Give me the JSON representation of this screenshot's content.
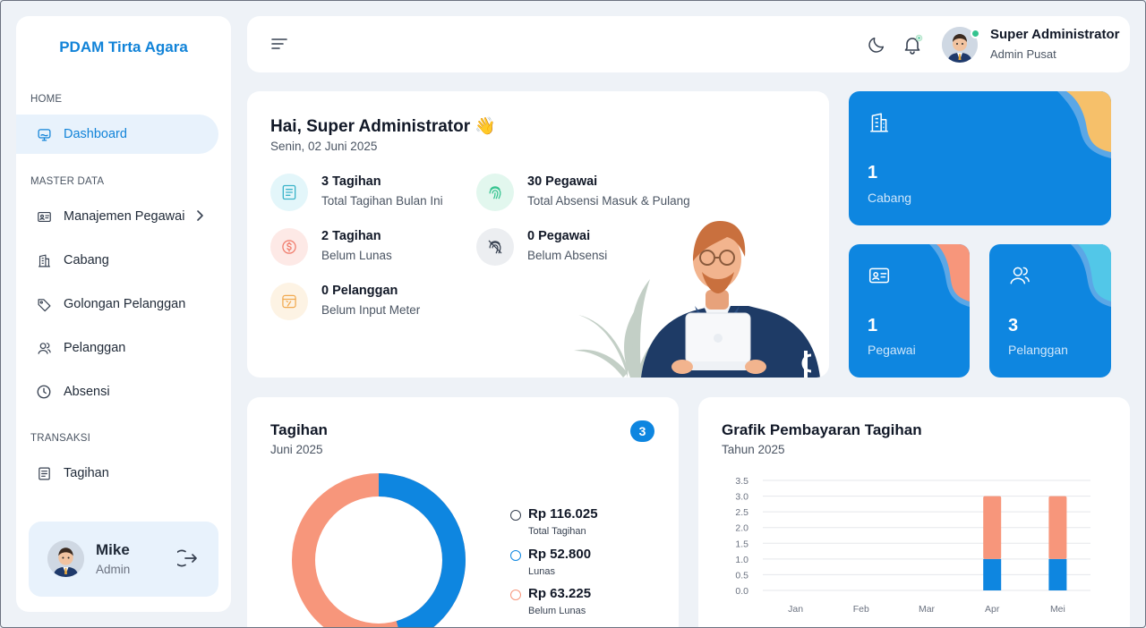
{
  "sidebar": {
    "brand": "PDAM Tirta Agara",
    "sections": [
      "HOME",
      "MASTER DATA",
      "TRANSAKSI"
    ],
    "items": [
      {
        "label": "Dashboard",
        "icon": "monitor-icon",
        "active": true
      },
      {
        "label": "Manajemen Pegawai",
        "icon": "id-card-icon"
      },
      {
        "label": "Cabang",
        "icon": "building-icon"
      },
      {
        "label": "Golongan Pelanggan",
        "icon": "tag-icon"
      },
      {
        "label": "Pelanggan",
        "icon": "users-icon"
      },
      {
        "label": "Absensi",
        "icon": "clock-icon"
      },
      {
        "label": "Tagihan",
        "icon": "receipt-icon"
      }
    ],
    "profile": {
      "name": "Mike",
      "role": "Admin"
    }
  },
  "topbar": {
    "user_name": "Super Administrator",
    "user_role": "Admin Pusat"
  },
  "welcome": {
    "greeting": "Hai, Super Administrator 👋",
    "date": "Senin, 02 Juni 2025",
    "stats": [
      {
        "title": "3 Tagihan",
        "sub": "Total Tagihan Bulan Ini",
        "icon": "receipt-icon",
        "color": "#3bb4c9",
        "bg": "#e3f6fa"
      },
      {
        "title": "30 Pegawai",
        "sub": "Total Absensi Masuk & Pulang",
        "icon": "fingerprint-icon",
        "color": "#34c38f",
        "bg": "#e2f7ee"
      },
      {
        "title": "2 Tagihan",
        "sub": "Belum Lunas",
        "icon": "dollar-circle-icon",
        "color": "#f07a6a",
        "bg": "#fde9e6"
      },
      {
        "title": "0 Pegawai",
        "sub": "Belum Absensi",
        "icon": "fingerprint-off-icon",
        "color": "#374151",
        "bg": "#eceef1"
      },
      {
        "title": "0 Pelanggan",
        "sub": "Belum Input Meter",
        "icon": "meter-icon",
        "color": "#f1a94f",
        "bg": "#fdf3e4"
      }
    ]
  },
  "tiles": [
    {
      "num": "1",
      "label": "Cabang",
      "icon": "building-icon"
    },
    {
      "num": "1",
      "label": "Pegawai",
      "icon": "id-card-icon"
    },
    {
      "num": "3",
      "label": "Pelanggan",
      "icon": "users-icon"
    }
  ],
  "tagihan": {
    "title": "Tagihan",
    "subtitle": "Juni 2025",
    "count": "3",
    "legend": [
      {
        "value": "Rp 116.025",
        "label": "Total Tagihan",
        "color": "#374151"
      },
      {
        "value": "Rp 52.800",
        "label": "Lunas",
        "color": "#0e86e0"
      },
      {
        "value": "Rp 63.225",
        "label": "Belum Lunas",
        "color": "#f7967b"
      }
    ],
    "donut": {
      "lunas": 52800,
      "belum_lunas": 63225
    }
  },
  "grafik": {
    "title": "Grafik Pembayaran Tagihan",
    "subtitle": "Tahun 2025"
  },
  "colors": {
    "primary": "#0e86e0",
    "accent": "#f7967b"
  },
  "chart_data": {
    "type": "bar",
    "stacked": true,
    "categories": [
      "Jan",
      "Feb",
      "Mar",
      "Apr",
      "Mei"
    ],
    "series": [
      {
        "color": "#0e86e0",
        "values": [
          0,
          0,
          0,
          1,
          1
        ]
      },
      {
        "color": "#f7967b",
        "values": [
          0,
          0,
          0,
          2,
          2
        ]
      }
    ],
    "ylim": [
      0,
      3.5
    ],
    "yticks": [
      "0.0",
      "0.5",
      "1.0",
      "1.5",
      "2.0",
      "2.5",
      "3.0",
      "3.5"
    ],
    "grid": true
  }
}
